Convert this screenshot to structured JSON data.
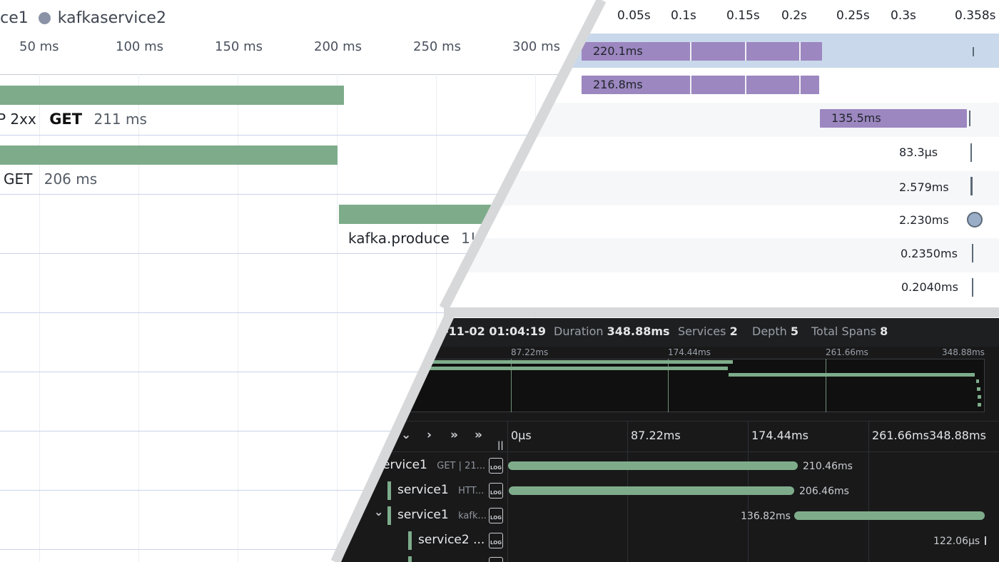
{
  "panel_a": {
    "legend": {
      "service1_partial": "ice1",
      "service2": "kafkaservice2"
    },
    "ticks": [
      "50 ms",
      "100 ms",
      "150 ms",
      "200 ms",
      "250 ms",
      "300 ms"
    ],
    "spans": [
      {
        "status": "P 2xx",
        "method": "GET",
        "duration": "211 ms"
      },
      {
        "method": "GET",
        "duration": "206 ms"
      },
      {
        "name": "kafka.produce",
        "duration_partial": "1!"
      }
    ]
  },
  "panel_b": {
    "ticks": [
      "0.05s",
      "0.1s",
      "0.15s",
      "0.2s",
      "0.25s",
      "0.3s",
      "0.358s"
    ],
    "rows": [
      {
        "duration": "220.1ms"
      },
      {
        "duration": "216.8ms"
      },
      {
        "duration": "135.5ms"
      },
      {
        "duration": "83.3µs"
      },
      {
        "duration": "2.579ms"
      },
      {
        "duration": "2.230ms"
      },
      {
        "duration": "0.2350ms"
      },
      {
        "duration": "0.2040ms"
      }
    ],
    "colors": {
      "bar": "#9c87c0",
      "selected_row": "#c9d8ea"
    }
  },
  "panel_c": {
    "header": {
      "timestamp_partial": "-11-02 01:04:19",
      "duration_label": "Duration",
      "duration_value": "348.88ms",
      "services_label": "Services",
      "services_value": "2",
      "depth_label": "Depth",
      "depth_value": "5",
      "spans_label": "Total Spans",
      "spans_value": "8"
    },
    "minimap_ticks": [
      "87.22ms",
      "174.44ms",
      "261.66ms",
      "348.88ms"
    ],
    "ruler_ticks": [
      "0µs",
      "87.22ms",
      "174.44ms",
      "261.66ms",
      "348.88ms"
    ],
    "nav_icons": [
      "chevron-down-icon",
      "chevron-right-icon",
      "double-chevron-down-icon",
      "double-chevron-right-icon"
    ],
    "rows": [
      {
        "service": "ervice1",
        "op": "GET | 21...",
        "duration": "210.46ms"
      },
      {
        "service": "service1",
        "op": "HTT...",
        "duration": "206.46ms"
      },
      {
        "service": "service1",
        "op": "kafk...",
        "duration": "136.82ms"
      },
      {
        "service": "service2 ...",
        "op": "",
        "duration": "122.06µs"
      }
    ],
    "log_label": "LOG",
    "colors": {
      "bar": "#7eac8b",
      "background": "#19191a"
    }
  }
}
